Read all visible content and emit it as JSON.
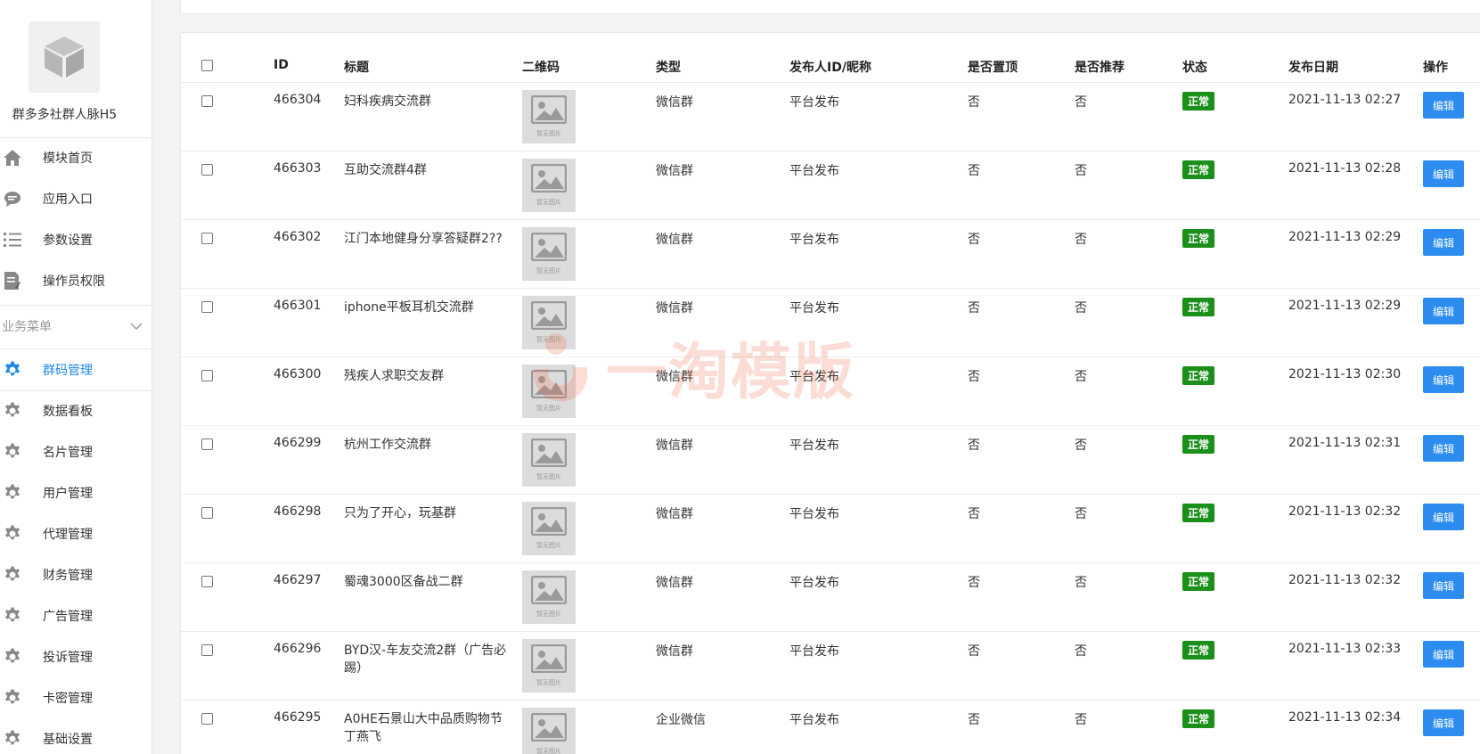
{
  "sidebar": {
    "app_name": "群多多社群人脉H5",
    "top_items": [
      {
        "label": "模块首页",
        "icon": "home-icon"
      },
      {
        "label": "应用入口",
        "icon": "chat-icon"
      },
      {
        "label": "参数设置",
        "icon": "list-icon"
      },
      {
        "label": "操作员权限",
        "icon": "document-edit-icon"
      }
    ],
    "section_title": "业务菜单",
    "business_items": [
      {
        "label": "群码管理",
        "active": true
      },
      {
        "label": "数据看板"
      },
      {
        "label": "名片管理"
      },
      {
        "label": "用户管理"
      },
      {
        "label": "代理管理"
      },
      {
        "label": "财务管理"
      },
      {
        "label": "广告管理"
      },
      {
        "label": "投诉管理"
      },
      {
        "label": "卡密管理"
      },
      {
        "label": "基础设置"
      }
    ]
  },
  "table": {
    "headers": {
      "id": "ID",
      "title": "标题",
      "qrcode": "二维码",
      "type": "类型",
      "publisher": "发布人ID/昵称",
      "pinned": "是否置顶",
      "recommended": "是否推荐",
      "status": "状态",
      "date": "发布日期",
      "action": "操作"
    },
    "qr_placeholder": "暂无图片",
    "edit_label": "编辑",
    "rows": [
      {
        "id": "466304",
        "title": "妇科疾病交流群",
        "type": "微信群",
        "publisher": "平台发布",
        "pinned": "否",
        "recommended": "否",
        "status": "正常",
        "date": "2021-11-13 02:27"
      },
      {
        "id": "466303",
        "title": "互助交流群4群",
        "type": "微信群",
        "publisher": "平台发布",
        "pinned": "否",
        "recommended": "否",
        "status": "正常",
        "date": "2021-11-13 02:28"
      },
      {
        "id": "466302",
        "title": "江门本地健身分享答疑群2??",
        "type": "微信群",
        "publisher": "平台发布",
        "pinned": "否",
        "recommended": "否",
        "status": "正常",
        "date": "2021-11-13 02:29"
      },
      {
        "id": "466301",
        "title": "iphone平板耳机交流群",
        "type": "微信群",
        "publisher": "平台发布",
        "pinned": "否",
        "recommended": "否",
        "status": "正常",
        "date": "2021-11-13 02:29"
      },
      {
        "id": "466300",
        "title": "残疾人求职交友群",
        "type": "微信群",
        "publisher": "平台发布",
        "pinned": "否",
        "recommended": "否",
        "status": "正常",
        "date": "2021-11-13 02:30"
      },
      {
        "id": "466299",
        "title": "杭州工作交流群",
        "type": "微信群",
        "publisher": "平台发布",
        "pinned": "否",
        "recommended": "否",
        "status": "正常",
        "date": "2021-11-13 02:31"
      },
      {
        "id": "466298",
        "title": "只为了开心，玩基群",
        "type": "微信群",
        "publisher": "平台发布",
        "pinned": "否",
        "recommended": "否",
        "status": "正常",
        "date": "2021-11-13 02:32"
      },
      {
        "id": "466297",
        "title": "蜀魂3000区备战二群",
        "type": "微信群",
        "publisher": "平台发布",
        "pinned": "否",
        "recommended": "否",
        "status": "正常",
        "date": "2021-11-13 02:32"
      },
      {
        "id": "466296",
        "title": "BYD汉-车友交流2群（广告必踢）",
        "type": "微信群",
        "publisher": "平台发布",
        "pinned": "否",
        "recommended": "否",
        "status": "正常",
        "date": "2021-11-13 02:33"
      },
      {
        "id": "466295",
        "title": "A0HE石景山大中品质购物节丁燕飞",
        "type": "企业微信",
        "publisher": "平台发布",
        "pinned": "否",
        "recommended": "否",
        "status": "正常",
        "date": "2021-11-13 02:34"
      }
    ]
  },
  "watermark": {
    "text": "一淘模版"
  },
  "colors": {
    "accent": "#1e88e5",
    "status_ok": "#1a8f1a",
    "edit_button": "#2d8cf0",
    "watermark": "#f06a4a"
  }
}
